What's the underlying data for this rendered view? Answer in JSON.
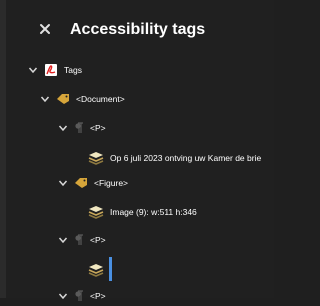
{
  "panel": {
    "title": "Accessibility tags"
  },
  "tree": {
    "root_label": "Tags",
    "document_label": "<Document>",
    "p1_label": "<P>",
    "p1_content": "Op 6 juli 2023 ontving uw Kamer de brie",
    "figure_label": "<Figure>",
    "figure_content": "Image (9): w:511 h:346",
    "p2_label": "<P>",
    "p3_label": "<P>"
  },
  "colors": {
    "background": "#202020",
    "text": "#ffffff",
    "chevron": "#d8d8d8",
    "tag_icon": "#d6a53a",
    "pdf_icon": "#e02020",
    "content_icon": "#e3d7a5",
    "cursor": "#4a90e2"
  }
}
